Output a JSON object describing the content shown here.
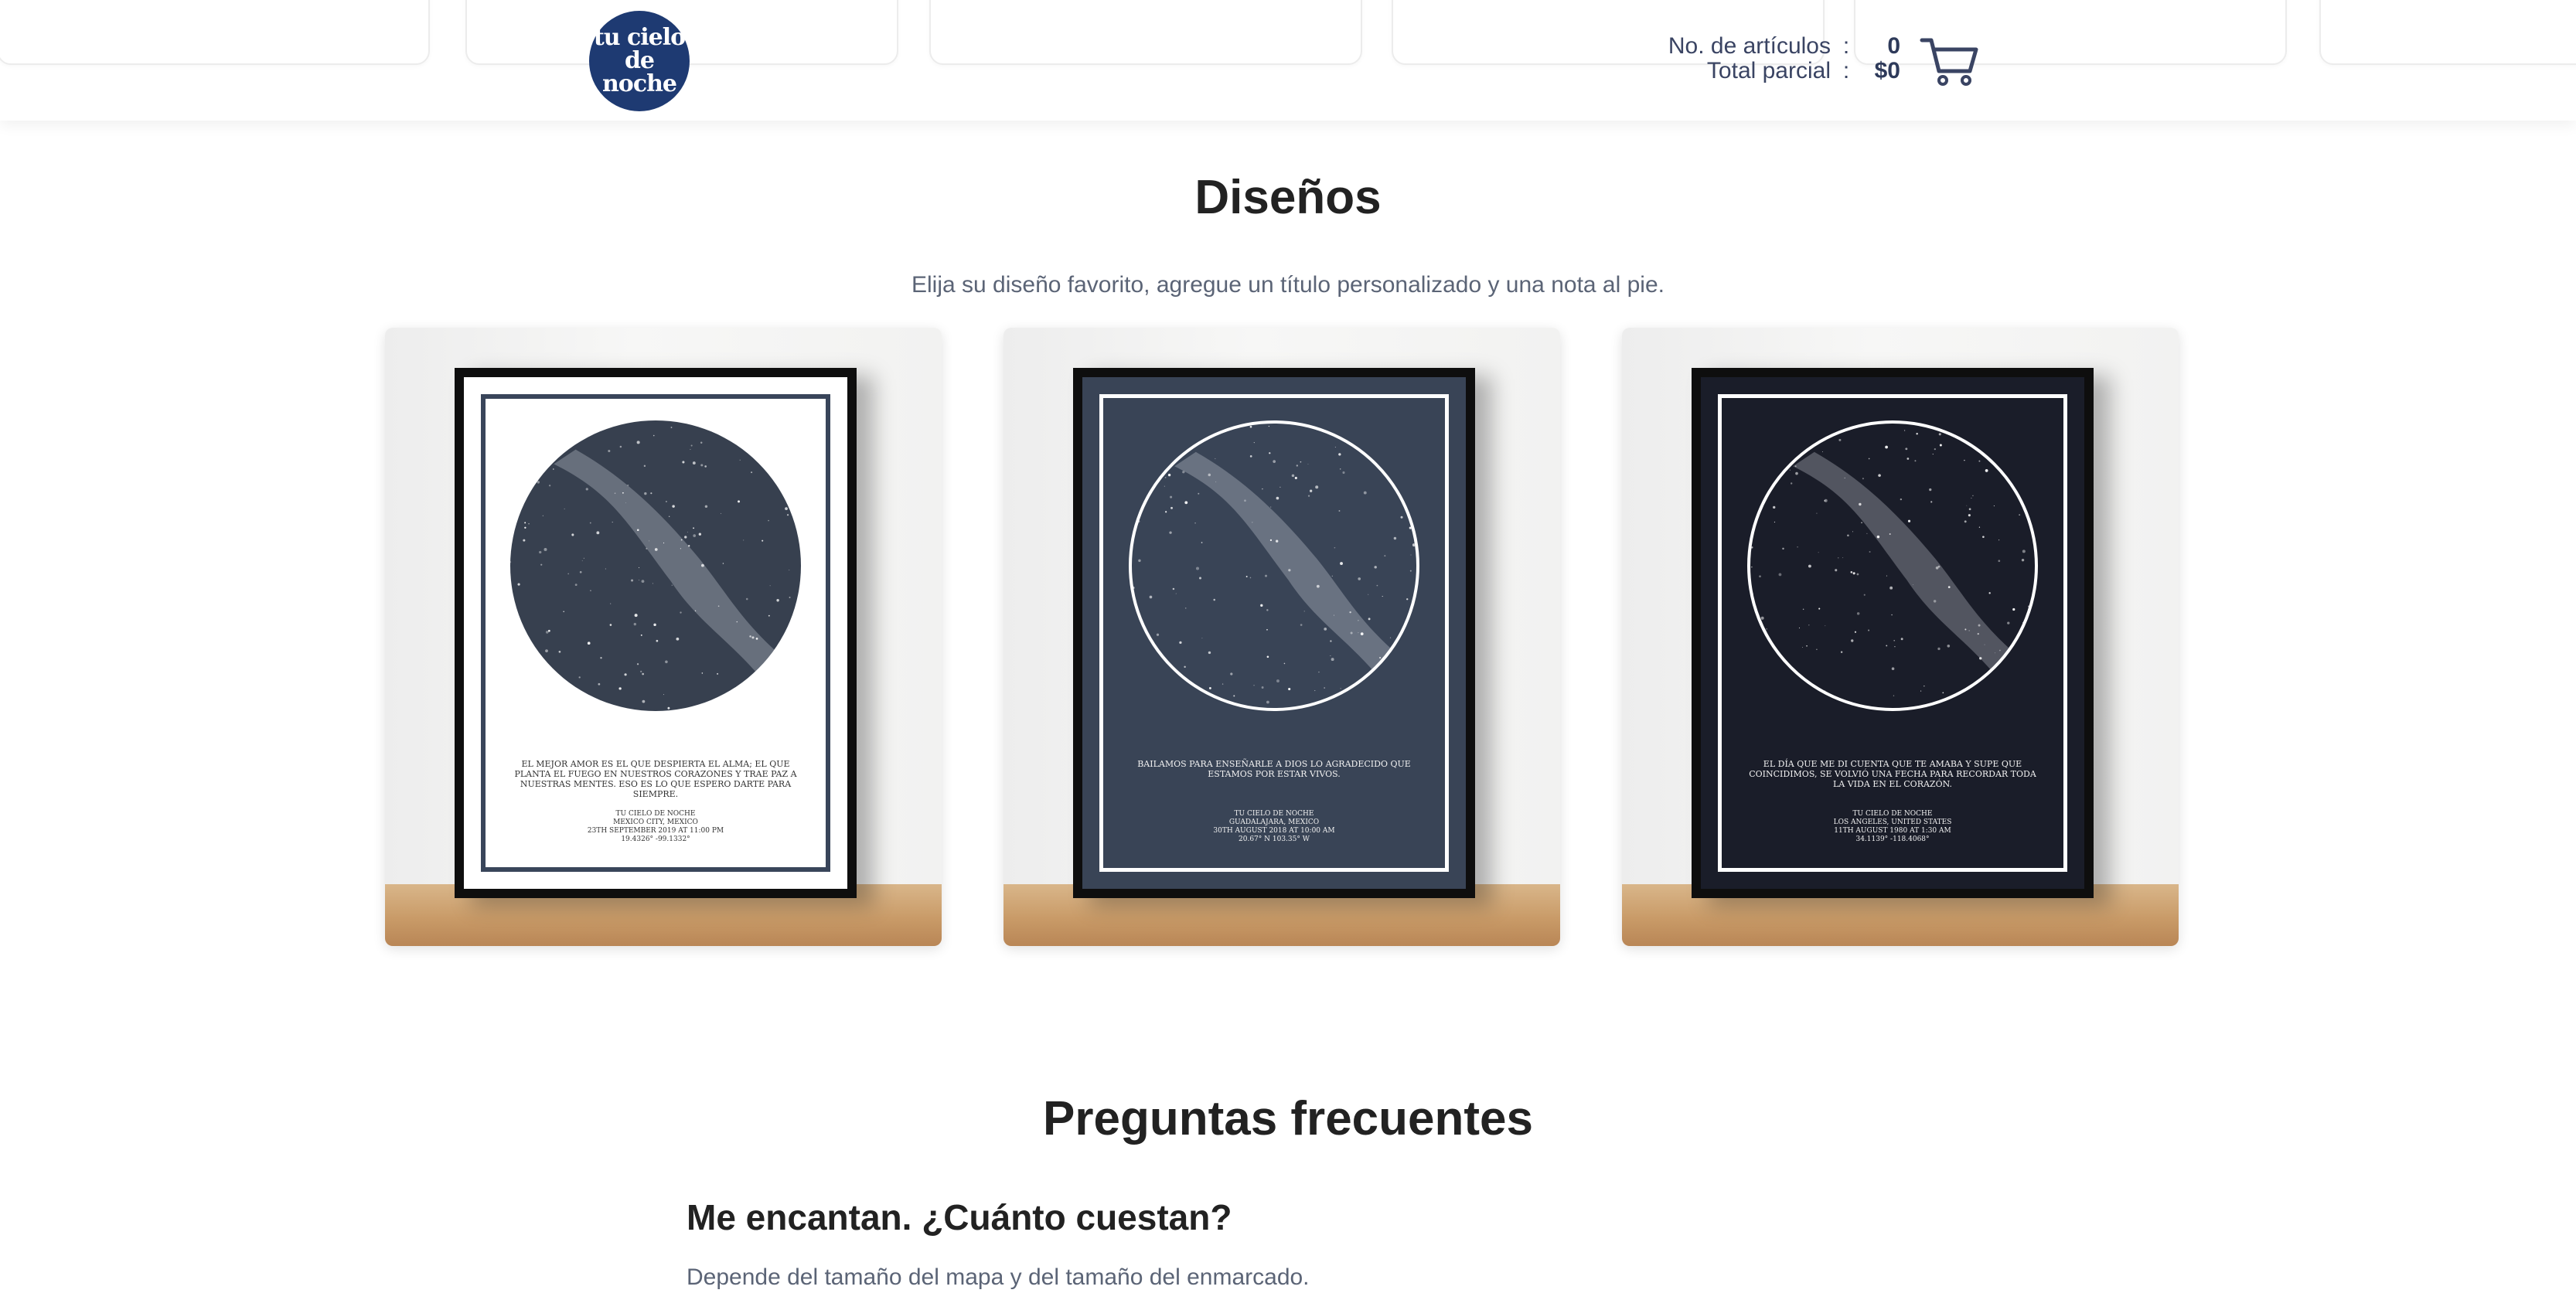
{
  "header": {
    "logo_line1": "tu cielo",
    "logo_line2": "de noche",
    "cart": {
      "items_label": "No. de artículos",
      "items_value": "0",
      "subtotal_label": "Total parcial",
      "subtotal_value": "$0",
      "separator": ":"
    },
    "cart_icon": "shopping-cart-icon"
  },
  "designs": {
    "title": "Diseños",
    "subtitle": "Elija su diseño favorito, agregue un título personalizado y una nota al pie.",
    "cards": [
      {
        "style": "white",
        "message": "EL MEJOR AMOR ES EL QUE DESPIERTA EL ALMA; EL QUE PLANTA EL FUEGO EN NUESTROS CORAZONES Y TRAE PAZ A NUESTRAS MENTES. ESO ES LO QUE ESPERO DARTE PARA SIEMPRE.",
        "info_1": "TU CIELO DE NOCHE",
        "info_2": "MEXICO CITY, MEXICO",
        "info_3": "23th SEPTEMBER 2019 at 11:00 PM",
        "info_4": "19.4326°   -99.1332°"
      },
      {
        "style": "slate",
        "message": "BAILAMOS PARA ENSEÑARLE A DIOS LO AGRADECIDO QUE ESTAMOS POR ESTAR VIVOS.",
        "info_1": "TU CIELO DE NOCHE",
        "info_2": "GUADALAJARA, MEXICO",
        "info_3": "30th AUGUST 2018 at 10:00 AM",
        "info_4": "20.67° N   103.35° W"
      },
      {
        "style": "midnight",
        "message": "EL DÍA QUE ME DI CUENTA QUE TE AMABA Y SUPE QUE COINCIDIMOS, SE VOLVIÓ UNA FECHA PARA RECORDAR TODA LA VIDA EN EL CORAZÓN.",
        "info_1": "TU CIELO DE NOCHE",
        "info_2": "LOS ANGELES, UNITED STATES",
        "info_3": "11th AUGUST 1980 at 1:30 AM",
        "info_4": "34.1139°   -118.4068°"
      }
    ]
  },
  "faq": {
    "title": "Preguntas frecuentes",
    "items": [
      {
        "question": "Me encantan. ¿Cuánto cuestan?",
        "answer": "Depende del tamaño del mapa y del tamaño del enmarcado."
      }
    ]
  },
  "colors": {
    "brand_navy": "#1e3a72",
    "text_muted": "#5b6476",
    "cart_text": "#3a4463"
  }
}
